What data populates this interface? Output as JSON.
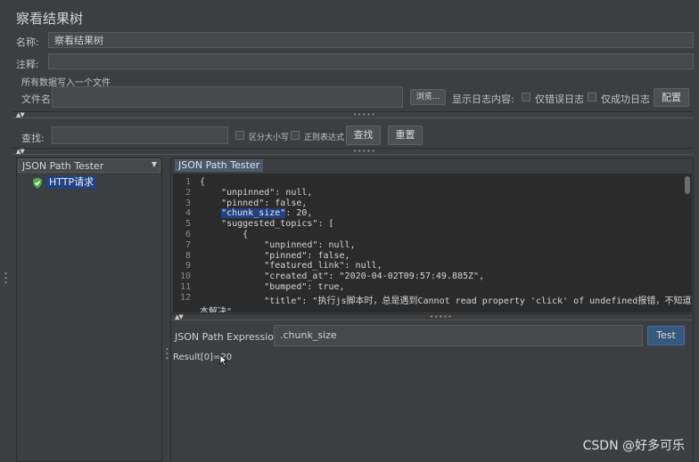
{
  "title": "察看结果树",
  "name_label": "名称:",
  "name_value": "察看结果树",
  "comment_label": "注释:",
  "comment_value": "",
  "file_section_label": "所有数据写入一个文件",
  "filename_label": "文件名",
  "filename_value": "",
  "browse_label": "浏览...",
  "log_content_label": "显示日志内容:",
  "errors_only_label": "仅错误日志",
  "success_only_label": "仅成功日志",
  "configure_label": "配置",
  "search": {
    "label": "查找:",
    "value": "",
    "case_sensitive_label": "区分大小写",
    "regex_label": "正则表达式",
    "find_button": "查找",
    "reset_button": "重置"
  },
  "renderer_select": "JSON Path Tester",
  "tree": {
    "items": [
      {
        "label": "HTTP请求",
        "status": "success"
      }
    ]
  },
  "tab_label": "JSON Path Tester",
  "response_lines": [
    {
      "n": "1",
      "t": "{"
    },
    {
      "n": "2",
      "t": "    \"unpinned\": null,"
    },
    {
      "n": "3",
      "t": "    \"pinned\": false,"
    },
    {
      "n": "4",
      "pre": "    ",
      "key": "\"chunk_size\"",
      "post": ": 20,"
    },
    {
      "n": "5",
      "t": "    \"suggested_topics\": ["
    },
    {
      "n": "6",
      "t": "        {"
    },
    {
      "n": "7",
      "t": "            \"unpinned\": null,"
    },
    {
      "n": "8",
      "t": "            \"pinned\": false,"
    },
    {
      "n": "9",
      "t": "            \"featured_link\": null,"
    },
    {
      "n": "10",
      "t": "            \"created_at\": \"2020-04-02T09:57:49.885Z\","
    },
    {
      "n": "11",
      "t": "            \"bumped\": true,"
    },
    {
      "n": "12",
      "t": "            \"title\": \"执行js脚本时，总是遇到Cannot read property 'click' of undefined报错，不知道如何根"
    },
    {
      "n": "",
      "t": "本解决\","
    }
  ],
  "expression": {
    "label": "JSON Path Expression",
    "value": ".chunk_size",
    "test_button": "Test"
  },
  "result_text": "Result[0]=20",
  "watermark": "CSDN @好多可乐",
  "colors": {
    "selection": "#214283",
    "success_icon": "#4caf50",
    "background": "#3c3f41",
    "editor": "#2b2b2b"
  }
}
